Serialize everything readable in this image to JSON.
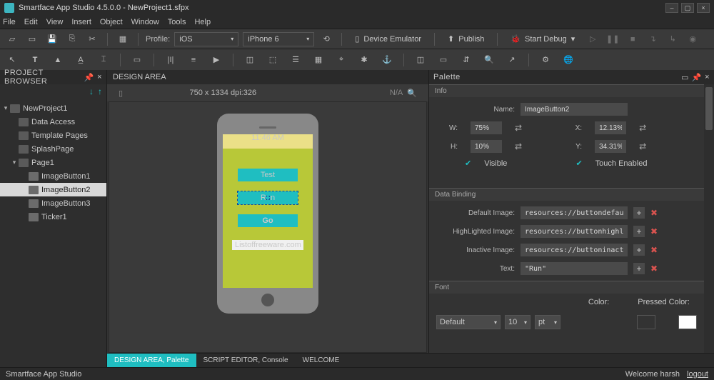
{
  "app": {
    "title": "Smartface App Studio 4.5.0.0 - NewProject1.sfpx",
    "name": "Smartface App Studio"
  },
  "menu": [
    "File",
    "Edit",
    "View",
    "Insert",
    "Object",
    "Window",
    "Tools",
    "Help"
  ],
  "toolbar1": {
    "profile_label": "Profile:",
    "profile_value": "iOS",
    "device_value": "iPhone 6",
    "emulator": "Device Emulator",
    "publish": "Publish",
    "debug": "Start Debug"
  },
  "project": {
    "panel_title": "PROJECT BROWSER",
    "root": "NewProject1",
    "nodes": {
      "data_access": "Data Access",
      "template_pages": "Template Pages",
      "splash": "SplashPage",
      "page1": "Page1",
      "ib1": "ImageButton1",
      "ib2": "ImageButton2",
      "ib3": "ImageButton3",
      "ticker": "Ticker1"
    }
  },
  "design": {
    "title": "DESIGN AREA",
    "dimensions": "750 x 1334 dpi:326",
    "na": "N/A",
    "time": "11:46 AM",
    "btn1": "Test",
    "btn2": "Run",
    "btn3": "Go",
    "ticker_text": "Listoffreeware.com"
  },
  "tabs": {
    "t1": "DESIGN AREA, Palette",
    "t2": "SCRIPT EDITOR, Console",
    "t3": "WELCOME"
  },
  "palette": {
    "title": "Palette",
    "section_info": "Info",
    "name_label": "Name:",
    "name_value": "ImageButton2",
    "w_label": "W:",
    "w_value": "75%",
    "h_label": "H:",
    "h_value": "10%",
    "x_label": "X:",
    "x_value": "12.13%",
    "y_label": "Y:",
    "34.31%": "34.31%",
    "y_value": "34.31%",
    "visible": "Visible",
    "touch": "Touch Enabled",
    "section_databinding": "Data Binding",
    "default_img": "Default Image:",
    "default_img_val": "resources://buttondefau…",
    "highlight_img": "HighLighted Image:",
    "highlight_img_val": "resources://buttonhighl…",
    "inactive_img": "Inactive Image:",
    "inactive_img_val": "resources://buttoninact…",
    "text_label": "Text:",
    "text_value": "\"Run\"",
    "section_font": "Font",
    "font_family": "Default",
    "font_size": "10",
    "font_unit": "pt",
    "color_label": "Color:",
    "pressed_color_label": "Pressed Color:"
  },
  "status": {
    "welcome": "Welcome harsh",
    "logout": "logout"
  }
}
